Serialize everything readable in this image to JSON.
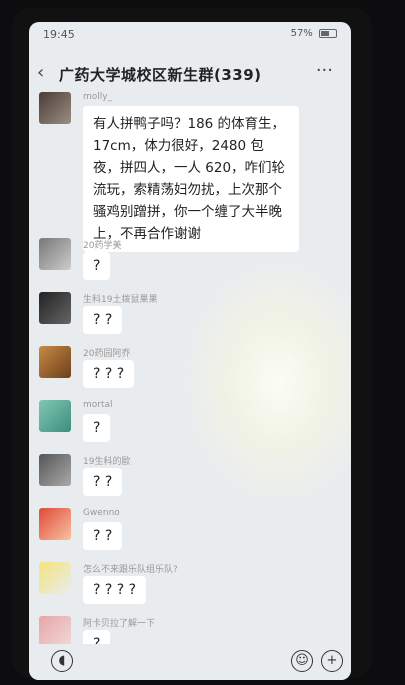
{
  "status_bar": {
    "time": "19:45",
    "battery": "57%"
  },
  "header": {
    "title": "广药大学城校区新生群(339)"
  },
  "messages": [
    {
      "nick": "molly_",
      "text": "有人拼鸭子吗？186 的体育生，17cm，体力很好，2480 包夜，拼四人，一人 620，咋们轮流玩，索精荡妇勿扰，上次那个骚鸡别蹭拼，你一个缠了大半晚上，不再合作谢谢"
    },
    {
      "nick": "20药学美",
      "text": "?"
    },
    {
      "nick": "生科19土拨鼠果果",
      "text": "? ?"
    },
    {
      "nick": "20药园阿乔",
      "text": "? ? ?"
    },
    {
      "nick": "mortal",
      "text": "?"
    },
    {
      "nick": "19生科的歐",
      "text": "? ?"
    },
    {
      "nick": "Gwenno",
      "text": "? ?"
    },
    {
      "nick": "怎么不来跟乐队组乐队?",
      "text": "? ? ? ?"
    },
    {
      "nick": "阿卡贝拉了解一下",
      "text": "?"
    }
  ],
  "colors": {
    "bubble": "#ffffff",
    "background": "#e9ecef"
  }
}
